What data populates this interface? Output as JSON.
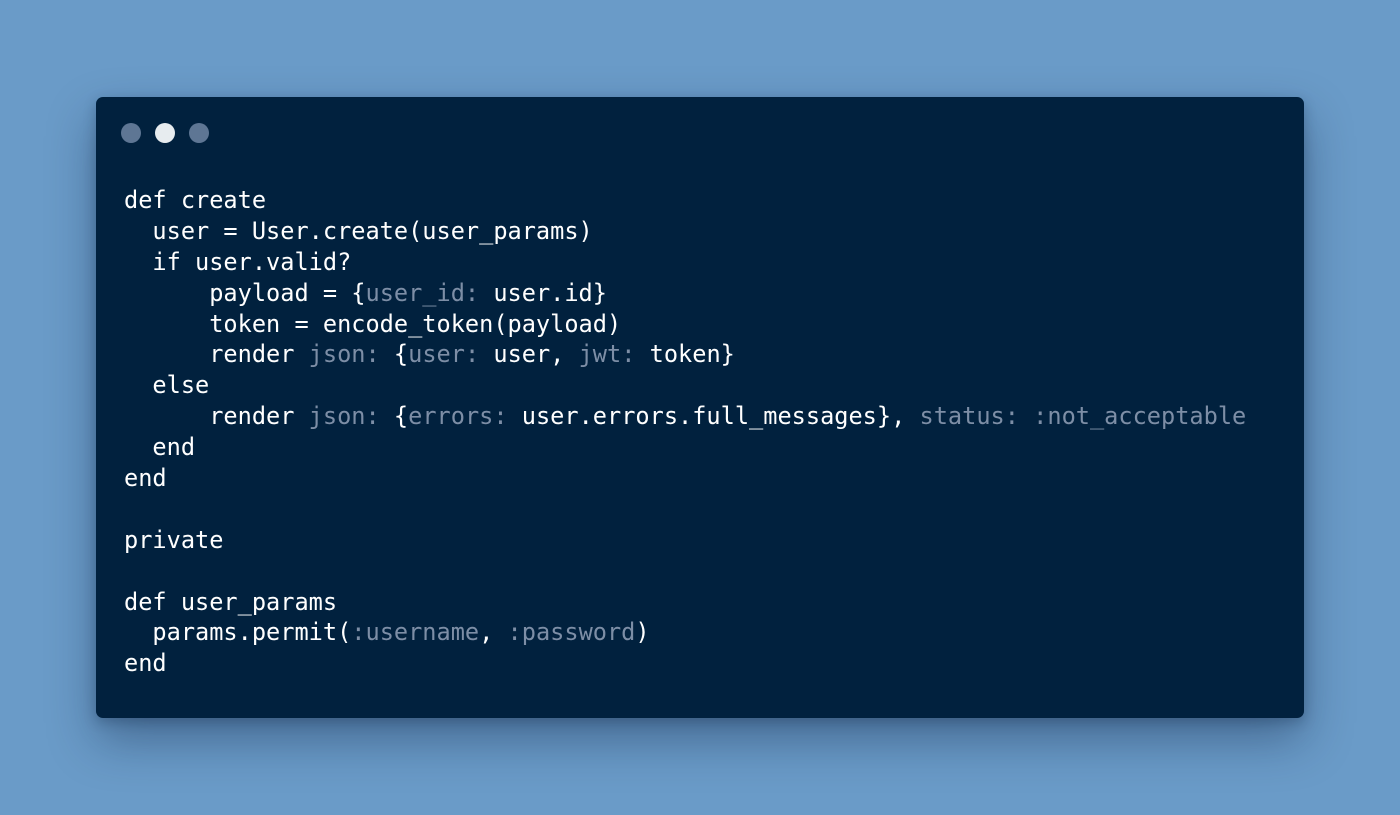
{
  "window": {
    "traffic_lights": [
      {
        "name": "close",
        "color": "#5e7694"
      },
      {
        "name": "minimize",
        "color": "#e7ecef"
      },
      {
        "name": "maximize",
        "color": "#5e7694"
      }
    ]
  },
  "editor": {
    "language": "ruby",
    "colors": {
      "background": "#01213e",
      "text": "#ffffff",
      "muted": "#7d8ea6"
    },
    "lines": [
      [
        {
          "t": "def create"
        }
      ],
      [
        {
          "t": "  user = User.create(user_params)"
        }
      ],
      [
        {
          "t": "  if user.valid?"
        }
      ],
      [
        {
          "t": "      payload = {"
        },
        {
          "t": "user_id:",
          "k": "key"
        },
        {
          "t": " user.id}"
        }
      ],
      [
        {
          "t": "      token = encode_token(payload)"
        }
      ],
      [
        {
          "t": "      render "
        },
        {
          "t": "json:",
          "k": "key"
        },
        {
          "t": " {"
        },
        {
          "t": "user:",
          "k": "key"
        },
        {
          "t": " user, "
        },
        {
          "t": "jwt:",
          "k": "key"
        },
        {
          "t": " token}"
        }
      ],
      [
        {
          "t": "  else"
        }
      ],
      [
        {
          "t": "      render "
        },
        {
          "t": "json:",
          "k": "key"
        },
        {
          "t": " {"
        },
        {
          "t": "errors:",
          "k": "key"
        },
        {
          "t": " user.errors.full_messages}, "
        },
        {
          "t": "status:",
          "k": "key"
        },
        {
          "t": " "
        },
        {
          "t": ":not_acceptable",
          "k": "sym"
        }
      ],
      [
        {
          "t": "  end"
        }
      ],
      [
        {
          "t": "end"
        }
      ],
      [
        {
          "t": ""
        }
      ],
      [
        {
          "t": "private"
        }
      ],
      [
        {
          "t": ""
        }
      ],
      [
        {
          "t": "def user_params"
        }
      ],
      [
        {
          "t": "  params.permit("
        },
        {
          "t": ":username",
          "k": "sym"
        },
        {
          "t": ", "
        },
        {
          "t": ":password",
          "k": "sym"
        },
        {
          "t": ")"
        }
      ],
      [
        {
          "t": "end"
        }
      ]
    ]
  }
}
